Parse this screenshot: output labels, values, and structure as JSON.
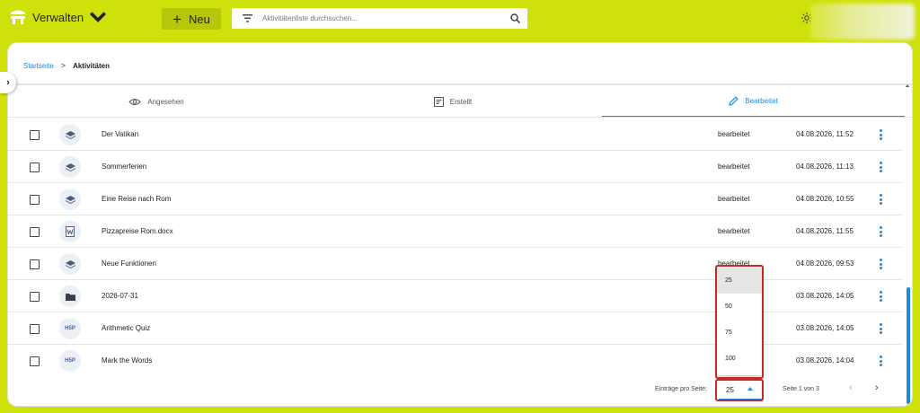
{
  "header": {
    "brand_label": "Verwalten",
    "new_label": "Neu",
    "search_placeholder": "Aktivitätenliste durchsuchen..."
  },
  "breadcrumb": {
    "home": "Startseite",
    "separator": ">",
    "current": "Aktivitäten"
  },
  "tabs": [
    {
      "label": "Angesehen",
      "icon": "eye-icon",
      "active": false
    },
    {
      "label": "Erstellt",
      "icon": "document-edit-icon",
      "active": false
    },
    {
      "label": "Bearbeitet",
      "icon": "pencil-icon",
      "active": true
    }
  ],
  "rows": [
    {
      "title": "Der Vatikan",
      "type_icon": "layers-icon",
      "status": "bearbeitet",
      "date": "04.08.2026, 11:52"
    },
    {
      "title": "Sommerferien",
      "type_icon": "layers-icon",
      "status": "bearbeitet",
      "date": "04.08.2026, 11:13"
    },
    {
      "title": "Eine Reise nach Rom",
      "type_icon": "layers-icon",
      "status": "bearbeitet",
      "date": "04.08.2026, 10:55"
    },
    {
      "title": "Pizzapreise Rom.docx",
      "type_icon": "word-document-icon",
      "status": "bearbeitet",
      "date": "04.08.2026, 11:55"
    },
    {
      "title": "Neue Funktionen",
      "type_icon": "layers-icon",
      "status": "bearbeitet",
      "date": "04.08.2026, 09:53"
    },
    {
      "title": "2026-07-31",
      "type_icon": "folder-icon",
      "status": "",
      "date": "03.08.2026, 14:05"
    },
    {
      "title": "Arithmetic Quiz",
      "type_icon": "h5p-icon",
      "h5p_label": "H5P",
      "status": "",
      "date": "03.08.2026, 14:05"
    },
    {
      "title": "Mark the Words",
      "type_icon": "h5p-icon",
      "h5p_label": "H5P",
      "status": "",
      "date": "03.08.2026, 14:04"
    }
  ],
  "pagination": {
    "per_page_label": "Einträge pro Seite:",
    "per_page_value": "25",
    "page_info": "Seite 1 von 3",
    "options": [
      "25",
      "50",
      "75",
      "100"
    ]
  },
  "colors": {
    "topbar": "#cfe10a",
    "accent": "#1e88e5",
    "highlight_box": "#c62828"
  }
}
